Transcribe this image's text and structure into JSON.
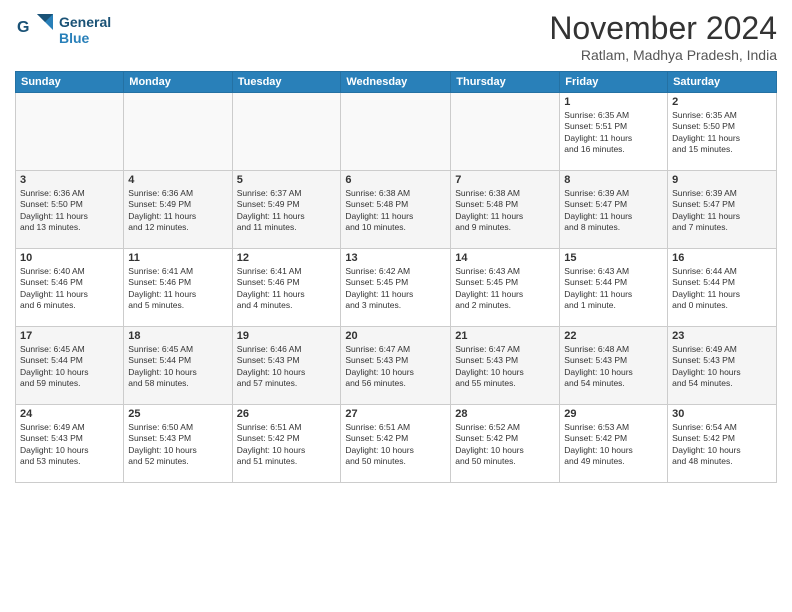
{
  "logo": {
    "line1": "General",
    "line2": "Blue"
  },
  "title": "November 2024",
  "subtitle": "Ratlam, Madhya Pradesh, India",
  "headers": [
    "Sunday",
    "Monday",
    "Tuesday",
    "Wednesday",
    "Thursday",
    "Friday",
    "Saturday"
  ],
  "weeks": [
    [
      {
        "day": "",
        "info": ""
      },
      {
        "day": "",
        "info": ""
      },
      {
        "day": "",
        "info": ""
      },
      {
        "day": "",
        "info": ""
      },
      {
        "day": "",
        "info": ""
      },
      {
        "day": "1",
        "info": "Sunrise: 6:35 AM\nSunset: 5:51 PM\nDaylight: 11 hours\nand 16 minutes."
      },
      {
        "day": "2",
        "info": "Sunrise: 6:35 AM\nSunset: 5:50 PM\nDaylight: 11 hours\nand 15 minutes."
      }
    ],
    [
      {
        "day": "3",
        "info": "Sunrise: 6:36 AM\nSunset: 5:50 PM\nDaylight: 11 hours\nand 13 minutes."
      },
      {
        "day": "4",
        "info": "Sunrise: 6:36 AM\nSunset: 5:49 PM\nDaylight: 11 hours\nand 12 minutes."
      },
      {
        "day": "5",
        "info": "Sunrise: 6:37 AM\nSunset: 5:49 PM\nDaylight: 11 hours\nand 11 minutes."
      },
      {
        "day": "6",
        "info": "Sunrise: 6:38 AM\nSunset: 5:48 PM\nDaylight: 11 hours\nand 10 minutes."
      },
      {
        "day": "7",
        "info": "Sunrise: 6:38 AM\nSunset: 5:48 PM\nDaylight: 11 hours\nand 9 minutes."
      },
      {
        "day": "8",
        "info": "Sunrise: 6:39 AM\nSunset: 5:47 PM\nDaylight: 11 hours\nand 8 minutes."
      },
      {
        "day": "9",
        "info": "Sunrise: 6:39 AM\nSunset: 5:47 PM\nDaylight: 11 hours\nand 7 minutes."
      }
    ],
    [
      {
        "day": "10",
        "info": "Sunrise: 6:40 AM\nSunset: 5:46 PM\nDaylight: 11 hours\nand 6 minutes."
      },
      {
        "day": "11",
        "info": "Sunrise: 6:41 AM\nSunset: 5:46 PM\nDaylight: 11 hours\nand 5 minutes."
      },
      {
        "day": "12",
        "info": "Sunrise: 6:41 AM\nSunset: 5:46 PM\nDaylight: 11 hours\nand 4 minutes."
      },
      {
        "day": "13",
        "info": "Sunrise: 6:42 AM\nSunset: 5:45 PM\nDaylight: 11 hours\nand 3 minutes."
      },
      {
        "day": "14",
        "info": "Sunrise: 6:43 AM\nSunset: 5:45 PM\nDaylight: 11 hours\nand 2 minutes."
      },
      {
        "day": "15",
        "info": "Sunrise: 6:43 AM\nSunset: 5:44 PM\nDaylight: 11 hours\nand 1 minute."
      },
      {
        "day": "16",
        "info": "Sunrise: 6:44 AM\nSunset: 5:44 PM\nDaylight: 11 hours\nand 0 minutes."
      }
    ],
    [
      {
        "day": "17",
        "info": "Sunrise: 6:45 AM\nSunset: 5:44 PM\nDaylight: 10 hours\nand 59 minutes."
      },
      {
        "day": "18",
        "info": "Sunrise: 6:45 AM\nSunset: 5:44 PM\nDaylight: 10 hours\nand 58 minutes."
      },
      {
        "day": "19",
        "info": "Sunrise: 6:46 AM\nSunset: 5:43 PM\nDaylight: 10 hours\nand 57 minutes."
      },
      {
        "day": "20",
        "info": "Sunrise: 6:47 AM\nSunset: 5:43 PM\nDaylight: 10 hours\nand 56 minutes."
      },
      {
        "day": "21",
        "info": "Sunrise: 6:47 AM\nSunset: 5:43 PM\nDaylight: 10 hours\nand 55 minutes."
      },
      {
        "day": "22",
        "info": "Sunrise: 6:48 AM\nSunset: 5:43 PM\nDaylight: 10 hours\nand 54 minutes."
      },
      {
        "day": "23",
        "info": "Sunrise: 6:49 AM\nSunset: 5:43 PM\nDaylight: 10 hours\nand 54 minutes."
      }
    ],
    [
      {
        "day": "24",
        "info": "Sunrise: 6:49 AM\nSunset: 5:43 PM\nDaylight: 10 hours\nand 53 minutes."
      },
      {
        "day": "25",
        "info": "Sunrise: 6:50 AM\nSunset: 5:43 PM\nDaylight: 10 hours\nand 52 minutes."
      },
      {
        "day": "26",
        "info": "Sunrise: 6:51 AM\nSunset: 5:42 PM\nDaylight: 10 hours\nand 51 minutes."
      },
      {
        "day": "27",
        "info": "Sunrise: 6:51 AM\nSunset: 5:42 PM\nDaylight: 10 hours\nand 50 minutes."
      },
      {
        "day": "28",
        "info": "Sunrise: 6:52 AM\nSunset: 5:42 PM\nDaylight: 10 hours\nand 50 minutes."
      },
      {
        "day": "29",
        "info": "Sunrise: 6:53 AM\nSunset: 5:42 PM\nDaylight: 10 hours\nand 49 minutes."
      },
      {
        "day": "30",
        "info": "Sunrise: 6:54 AM\nSunset: 5:42 PM\nDaylight: 10 hours\nand 48 minutes."
      }
    ]
  ]
}
